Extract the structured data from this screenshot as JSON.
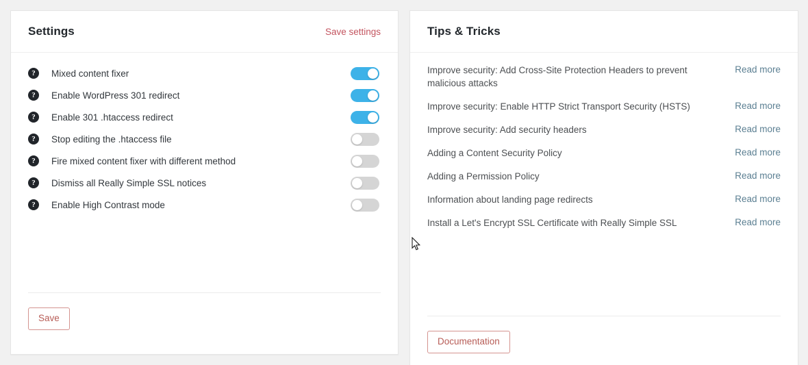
{
  "settings_panel": {
    "title": "Settings",
    "save_settings_link": "Save settings",
    "help_icon_glyph": "?",
    "rows": [
      {
        "label": "Mixed content fixer",
        "state": "on"
      },
      {
        "label": "Enable WordPress 301 redirect",
        "state": "on"
      },
      {
        "label": "Enable 301 .htaccess redirect",
        "state": "on"
      },
      {
        "label": "Stop editing the .htaccess file",
        "state": "off"
      },
      {
        "label": "Fire mixed content fixer with different method",
        "state": "off"
      },
      {
        "label": "Dismiss all Really Simple SSL notices",
        "state": "off"
      },
      {
        "label": "Enable High Contrast mode",
        "state": "off"
      }
    ],
    "save_button": "Save"
  },
  "tips_panel": {
    "title": "Tips & Tricks",
    "read_more_label": "Read more",
    "tips": [
      {
        "text": "Improve security: Add Cross-Site Protection Headers to prevent malicious attacks",
        "link": "Read more"
      },
      {
        "text": "Improve security: Enable HTTP Strict Transport Security (HSTS)",
        "link": "Read more"
      },
      {
        "text": "Improve security: Add security headers",
        "link": "Read more"
      },
      {
        "text": "Adding a Content Security Policy",
        "link": "Read more"
      },
      {
        "text": "Adding a Permission Policy",
        "link": "Read more"
      },
      {
        "text": "Information about landing page redirects",
        "link": "Read more"
      },
      {
        "text": "Install a Let's Encrypt SSL Certificate with Really Simple SSL",
        "link": "Read more"
      }
    ],
    "documentation_button": "Documentation"
  },
  "colors": {
    "page_background": "#f1f1f1",
    "panel_background": "#ffffff",
    "toggle_on": "#3db2e8",
    "toggle_off": "#d5d5d5",
    "accent_link": "#c3545f",
    "button_border": "#d4938f",
    "button_text": "#b75c56",
    "read_more_link": "#5b7f92",
    "help_icon": "#21252a"
  }
}
